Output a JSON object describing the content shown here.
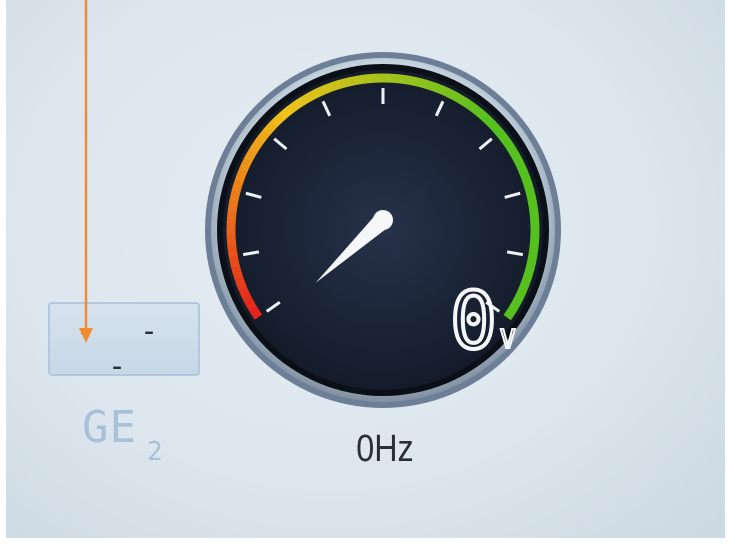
{
  "selector": {
    "value": "- - -",
    "gas_name": "GE",
    "gas_sub": "2"
  },
  "gauge": {
    "voltage_value": "0",
    "voltage_unit": "V",
    "needle_fraction": 0.0
  },
  "frequency": {
    "label": "0Hz"
  },
  "colors": {
    "gauge_face": "#1a2436",
    "red_zone": "#e3241b",
    "yellow_zone": "#f0c21a",
    "green_zone": "#56c01e",
    "annotation_arrow": "#f28a2e"
  }
}
